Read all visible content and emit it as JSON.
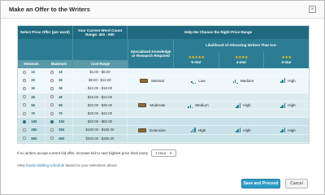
{
  "dialog": {
    "title": "Make an Offer to the Writers",
    "close_icon": "×"
  },
  "table": {
    "col_price": "Select Price Offer (per word)",
    "sub_min": "Minimum",
    "sub_max": "Maximum",
    "col_wordcount": "Your Current Word Count Range: 400 - 600",
    "sub_cost": "Cost Range",
    "col_help": "Help Me Choose the Right Price Range",
    "col_specialized": "Specialized Knowledge or Research Required",
    "col_likelihood": "Likelihood of Attracting Writers That Are:",
    "star_5": "5-star",
    "star_4": "4-star",
    "star_3": "3-star",
    "rows": [
      {
        "min": "1¢",
        "max": "1¢",
        "cost": "$4.00 - $6.00"
      },
      {
        "min": "2¢",
        "max": "2¢",
        "cost": "$8.00 - $12.00"
      },
      {
        "min": "3¢",
        "max": "3¢",
        "cost": "$12.00 - $18.00"
      },
      {
        "min": "4¢",
        "max": "4¢",
        "cost": "$16.00 - $24.00"
      },
      {
        "min": "5¢",
        "max": "5¢",
        "cost": "$20.00 - $30.00"
      },
      {
        "min": "7¢",
        "max": "7¢",
        "cost": "$28.00 - $42.00"
      },
      {
        "min": "10¢",
        "max": "10¢",
        "cost": "$40.00 - $60.00"
      },
      {
        "min": "25¢",
        "max": "25¢",
        "cost": "$100.00 - $150.00"
      },
      {
        "min": "50¢",
        "max": "50¢",
        "cost": "$200.00 - $300.00"
      }
    ],
    "groups": [
      {
        "tier": "Minimal",
        "l5": "Low",
        "l4": "Medium",
        "l3": "High"
      },
      {
        "tier": "Moderate",
        "l5": "Medium",
        "l4": "High",
        "l3": "High"
      },
      {
        "tier": "Extensive",
        "l5": "High",
        "l4": "High",
        "l3": "High"
      }
    ]
  },
  "footer": {
    "increase_text": "If no writers accept current bid offer, increase bid to next highest price level every",
    "interval_value": "1 Hour",
    "view_prefix": "View",
    "view_link": "hourly bidding schedule",
    "view_suffix": "based on your selections above."
  },
  "buttons": {
    "save": "Save and Proceed",
    "cancel": "Cancel"
  },
  "selected": {
    "min_index": 6,
    "max_index": 6
  }
}
